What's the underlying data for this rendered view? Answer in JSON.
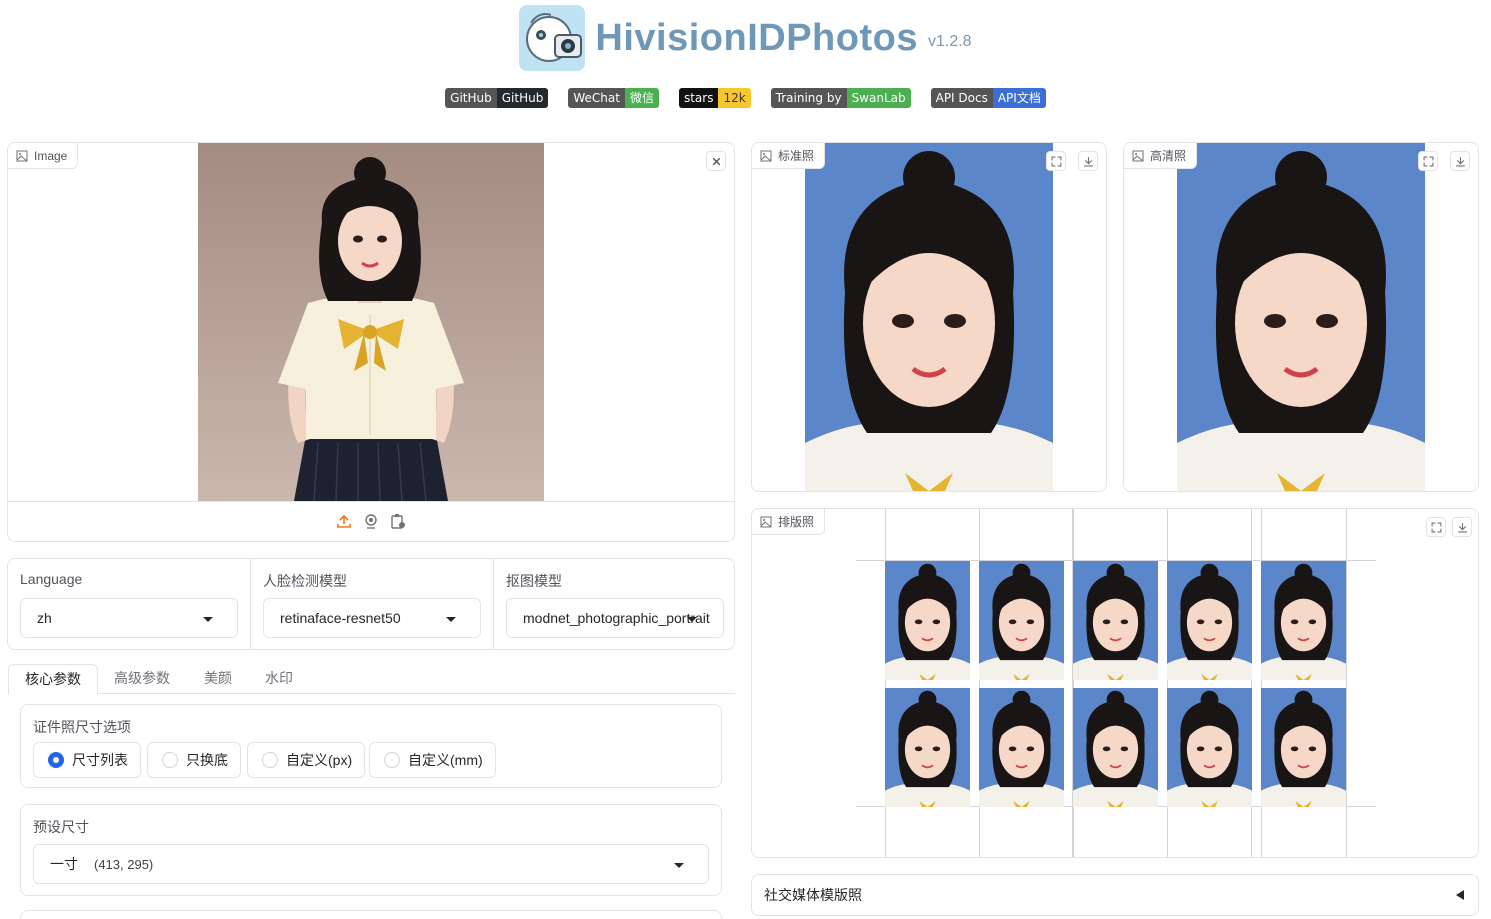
{
  "header": {
    "title": "HivisionIDPhotos",
    "version": "v1.2.8"
  },
  "badges": [
    {
      "left": "GitHub",
      "right": "GitHub",
      "color": "#24292e"
    },
    {
      "left": "WeChat",
      "right": "微信",
      "color": "#4caf50"
    },
    {
      "left": "stars",
      "right": "12k",
      "color": "#f7c52c",
      "left_color": "#111111",
      "right_text_color": "#333333"
    },
    {
      "left": "Training by",
      "right": "SwanLab",
      "color": "#4caf50"
    },
    {
      "left": "API Docs",
      "right": "API文档",
      "color": "#3b6fd6"
    }
  ],
  "input_panel": {
    "label": "Image"
  },
  "output_panels": {
    "standard": "标准照",
    "hd": "高清照",
    "layout": "排版照"
  },
  "dropdowns": {
    "language": {
      "label": "Language",
      "value": "zh"
    },
    "face_model": {
      "label": "人脸检测模型",
      "value": "retinaface-resnet50"
    },
    "matting_model": {
      "label": "抠图模型",
      "value": "modnet_photographic_portrait"
    }
  },
  "tabs": [
    "核心参数",
    "高级参数",
    "美颜",
    "水印"
  ],
  "size_options": {
    "label": "证件照尺寸选项",
    "options": [
      "尺寸列表",
      "只换底",
      "自定义(px)",
      "自定义(mm)"
    ],
    "selected": "尺寸列表"
  },
  "preset_size": {
    "label": "预设尺寸",
    "value": "一寸",
    "dims": "(413, 295)"
  },
  "social_accordion": "社交媒体模版照",
  "colors": {
    "accent": "#2563eb",
    "id_background": "#5b86c9",
    "upload_icon": "#f97316"
  }
}
